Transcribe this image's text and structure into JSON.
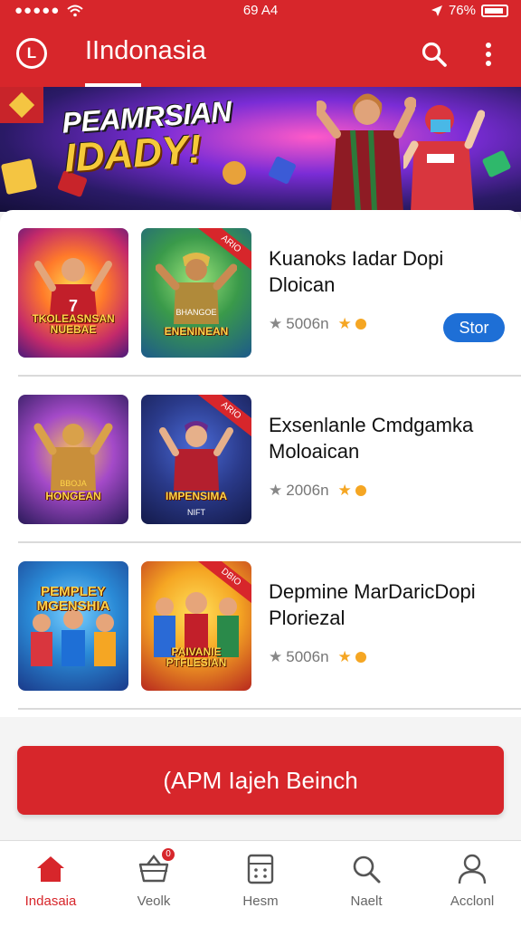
{
  "status_bar": {
    "time": "69 A4",
    "battery": "76%"
  },
  "app_bar": {
    "title": "IIndonasia",
    "logo_letter": "L"
  },
  "banner": {
    "line1": "PEAMRSIAN",
    "line2": "IDADY!"
  },
  "games": [
    {
      "title": "Kuanoks Iadar Dopi Dloican",
      "rating": "5006n",
      "thumb1_caption": "TKOLEASNSAN NUEBAE",
      "thumb2_caption": "ENENINEAN",
      "thumb2_sub": "BHANGOE",
      "ribbon": "ARIO",
      "action_label": "Stor"
    },
    {
      "title": "Exsenlanle Cmdgamka Moloaican",
      "rating": "2006n",
      "thumb1_caption": "HONGEAN",
      "thumb1_sub": "BBOJA",
      "thumb2_caption": "IMPENSIMA",
      "thumb2_sub": "NIFT",
      "ribbon": "ARIO"
    },
    {
      "title": "Depmine MarDaricDopi Ploriezal",
      "rating": "5006n",
      "thumb1_caption": "PEMPLEY MGENSHIA",
      "thumb2_caption": "PAIVANIE PTFLESIAN",
      "ribbon": "DBIO"
    }
  ],
  "cta": {
    "label": "(APM Iajeh Beinch"
  },
  "bottom_nav": [
    {
      "label": "Indasaia",
      "icon": "home-icon",
      "active": true,
      "badge": ""
    },
    {
      "label": "Veolk",
      "icon": "basket-icon",
      "active": false,
      "badge": "0"
    },
    {
      "label": "Hesm",
      "icon": "calculator-icon",
      "active": false,
      "badge": ""
    },
    {
      "label": "Naelt",
      "icon": "search-icon",
      "active": false,
      "badge": ""
    },
    {
      "label": "Acclonl",
      "icon": "person-icon",
      "active": false,
      "badge": ""
    }
  ],
  "colors": {
    "brand_red": "#d7262b",
    "store_blue": "#1e6fd6",
    "star_orange": "#f5a623"
  }
}
